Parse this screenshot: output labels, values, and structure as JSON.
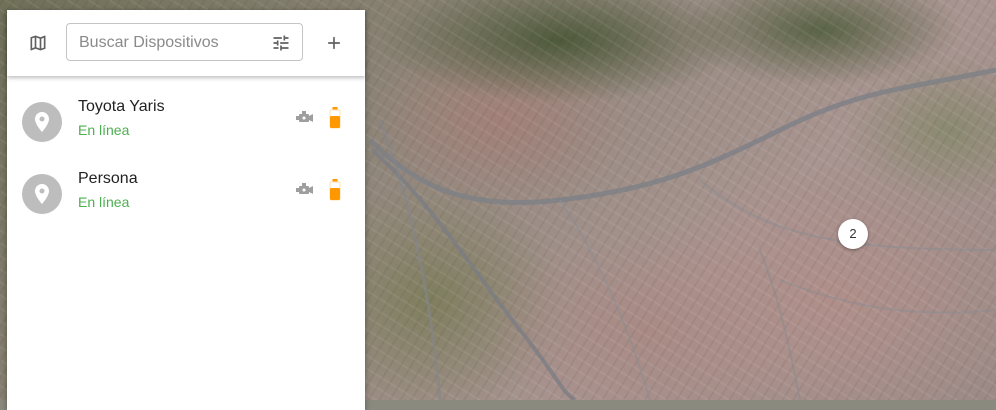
{
  "toolbar": {
    "map_icon": "map-icon",
    "search_placeholder": "Buscar Dispositivos",
    "search_value": "",
    "filter_icon": "tune-icon",
    "add_icon": "plus-icon"
  },
  "devices": [
    {
      "name": "Toyota Yaris",
      "status": "En línea",
      "status_color": "#4caf50",
      "icon": "location-pin-icon",
      "engine_icon": "engine-icon",
      "battery_icon": "battery-icon",
      "battery_color": "#ff9800"
    },
    {
      "name": "Persona",
      "status": "En línea",
      "status_color": "#4caf50",
      "icon": "location-pin-icon",
      "engine_icon": "engine-icon",
      "battery_icon": "battery-icon",
      "battery_color": "#ff9800"
    }
  ],
  "map": {
    "cluster_count": "2"
  }
}
